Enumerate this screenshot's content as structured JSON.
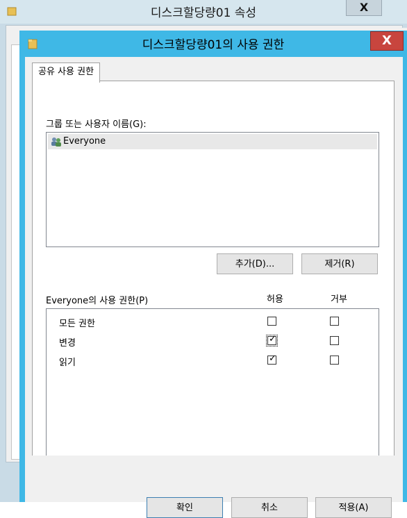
{
  "background_window": {
    "title": "디스크할당량01 속성",
    "close_glyph": "X"
  },
  "dialog": {
    "title": "디스크할당량01의 사용 권한",
    "close_glyph": "X",
    "tab_label": "공유 사용 권한",
    "group_label": "그룹 또는 사용자 이름(G):",
    "users": [
      {
        "name": "Everyone"
      }
    ],
    "add_button": "추가(D)...",
    "remove_button": "제거(R)",
    "permissions_label": "Everyone의 사용 권한(P)",
    "allow_header": "허용",
    "deny_header": "거부",
    "permissions": [
      {
        "name": "모든 권한",
        "allow": false,
        "deny": false
      },
      {
        "name": "변경",
        "allow": true,
        "deny": false
      },
      {
        "name": "읽기",
        "allow": true,
        "deny": false
      }
    ],
    "ok_button": "확인",
    "cancel_button": "취소",
    "apply_button": "적용(A)"
  },
  "colors": {
    "dialog_frame": "#3fb8e6",
    "close_button": "#c8453e",
    "background_frame": "#c9dbe6"
  }
}
